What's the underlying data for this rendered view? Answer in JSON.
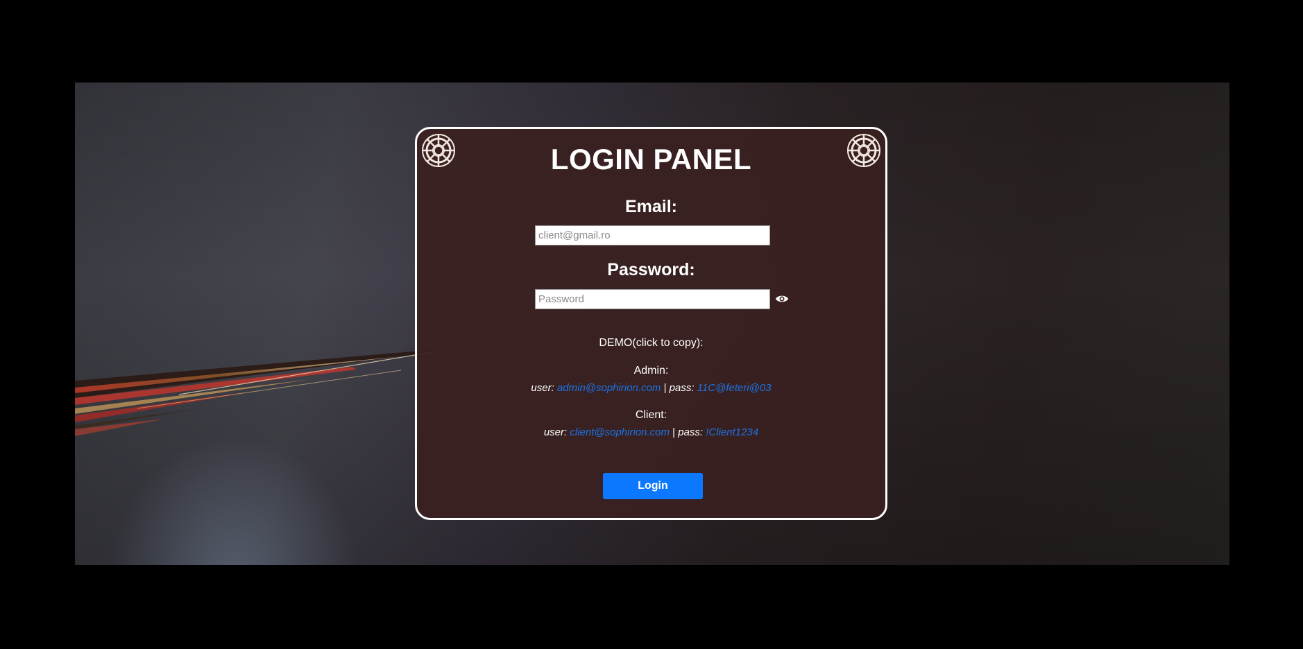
{
  "panel": {
    "title": "LOGIN PANEL",
    "corner_icons": [
      "ship-wheel-icon",
      "ship-wheel-icon"
    ]
  },
  "email": {
    "label": "Email:",
    "placeholder": "client@gmail.ro",
    "value": ""
  },
  "password": {
    "label": "Password:",
    "placeholder": "Password",
    "value": "",
    "toggle_icon": "eye-icon"
  },
  "demo": {
    "title": "DEMO(click to copy):",
    "admin": {
      "label": "Admin:",
      "user_prefix": "user:",
      "user": "admin@sophirion.com",
      "separator": "|",
      "pass_prefix": "pass:",
      "pass": "11C@feteri@03"
    },
    "client": {
      "label": "Client:",
      "user_prefix": "user:",
      "user": "client@sophirion.com",
      "separator": "|",
      "pass_prefix": "pass:",
      "pass": "!Client1234"
    }
  },
  "actions": {
    "login_label": "Login"
  },
  "colors": {
    "panel_bg": "#3a2020",
    "link": "#1a73e8",
    "button": "#0b78ff",
    "border": "#ffffff"
  }
}
